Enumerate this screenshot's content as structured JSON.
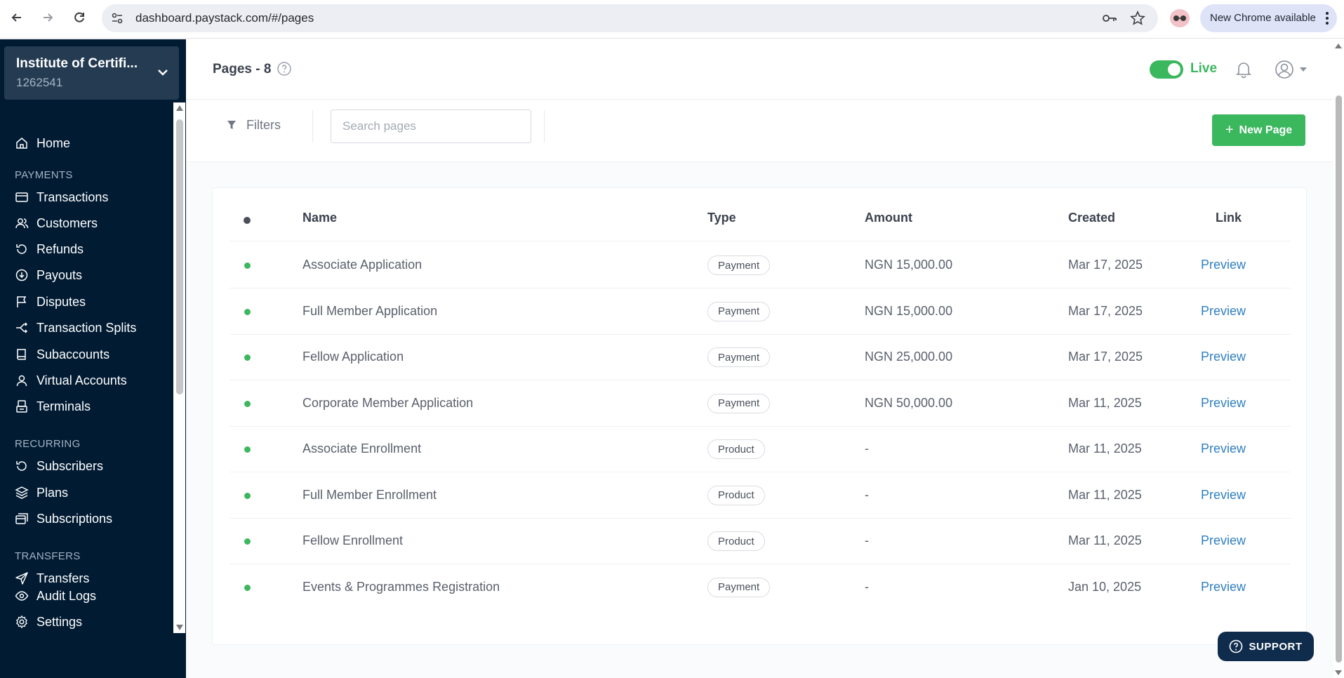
{
  "browser": {
    "url": "dashboard.paystack.com/#/pages",
    "update_label": "New Chrome available"
  },
  "sidebar": {
    "business_name": "Institute of Certifi...",
    "business_id": "1262541",
    "home": "Home",
    "sections": [
      {
        "title": "PAYMENTS",
        "items": [
          "Transactions",
          "Customers",
          "Refunds",
          "Payouts",
          "Disputes",
          "Transaction Splits",
          "Subaccounts",
          "Virtual Accounts",
          "Terminals"
        ]
      },
      {
        "title": "RECURRING",
        "items": [
          "Subscribers",
          "Plans",
          "Subscriptions"
        ]
      },
      {
        "title": "TRANSFERS",
        "items": [
          "Transfers"
        ]
      }
    ],
    "bottom_items": [
      "Audit Logs",
      "Settings"
    ]
  },
  "header": {
    "title": "Pages - 8",
    "mode_label": "Live"
  },
  "toolbar": {
    "filters_label": "Filters",
    "search_placeholder": "Search pages",
    "new_page_label": "New Page"
  },
  "table": {
    "columns": [
      "Name",
      "Type",
      "Amount",
      "Created",
      "Link"
    ],
    "rows": [
      {
        "name": "Associate Application",
        "type": "Payment",
        "amount": "NGN 15,000.00",
        "created": "Mar 17, 2025",
        "link": "Preview"
      },
      {
        "name": "Full Member Application",
        "type": "Payment",
        "amount": "NGN 15,000.00",
        "created": "Mar 17, 2025",
        "link": "Preview"
      },
      {
        "name": "Fellow Application",
        "type": "Payment",
        "amount": "NGN 25,000.00",
        "created": "Mar 17, 2025",
        "link": "Preview"
      },
      {
        "name": "Corporate Member Application",
        "type": "Payment",
        "amount": "NGN 50,000.00",
        "created": "Mar 11, 2025",
        "link": "Preview"
      },
      {
        "name": "Associate Enrollment",
        "type": "Product",
        "amount": "-",
        "created": "Mar 11, 2025",
        "link": "Preview"
      },
      {
        "name": "Full Member Enrollment",
        "type": "Product",
        "amount": "-",
        "created": "Mar 11, 2025",
        "link": "Preview"
      },
      {
        "name": "Fellow Enrollment",
        "type": "Product",
        "amount": "-",
        "created": "Mar 11, 2025",
        "link": "Preview"
      },
      {
        "name": "Events & Programmes Registration",
        "type": "Payment",
        "amount": "-",
        "created": "Jan 10, 2025",
        "link": "Preview"
      }
    ]
  },
  "support_label": "SUPPORT",
  "colors": {
    "sidebar_bg": "#011b33",
    "accent_green": "#3bb75e",
    "link_blue": "#2f7fc1"
  }
}
